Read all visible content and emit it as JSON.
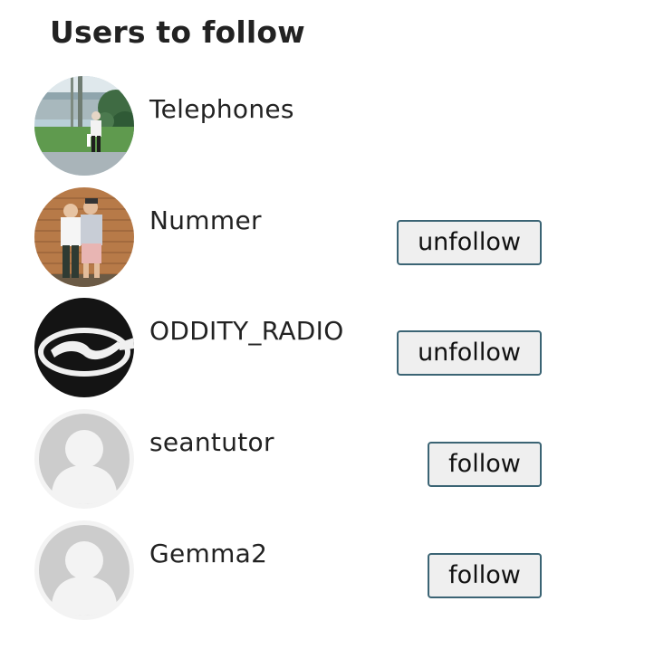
{
  "panel": {
    "title": "Users to follow"
  },
  "users": [
    {
      "username": "Telephones",
      "avatar": "photo-person-outdoors",
      "action": null
    },
    {
      "username": "Nummer",
      "avatar": "photo-two-people-brick-wall",
      "action": "unfollow"
    },
    {
      "username": "ODDITY_RADIO",
      "avatar": "logo-oddity-radio",
      "action": "unfollow"
    },
    {
      "username": "seantutor",
      "avatar": "default-user-icon",
      "action": "follow"
    },
    {
      "username": "Gemma2",
      "avatar": "default-user-icon",
      "action": "follow"
    }
  ],
  "colors": {
    "button_border": "#3b6474",
    "button_bg": "#efefef",
    "text": "#222222",
    "default_avatar_bg": "#cccccc",
    "default_avatar_fg": "#f3f3f3"
  }
}
